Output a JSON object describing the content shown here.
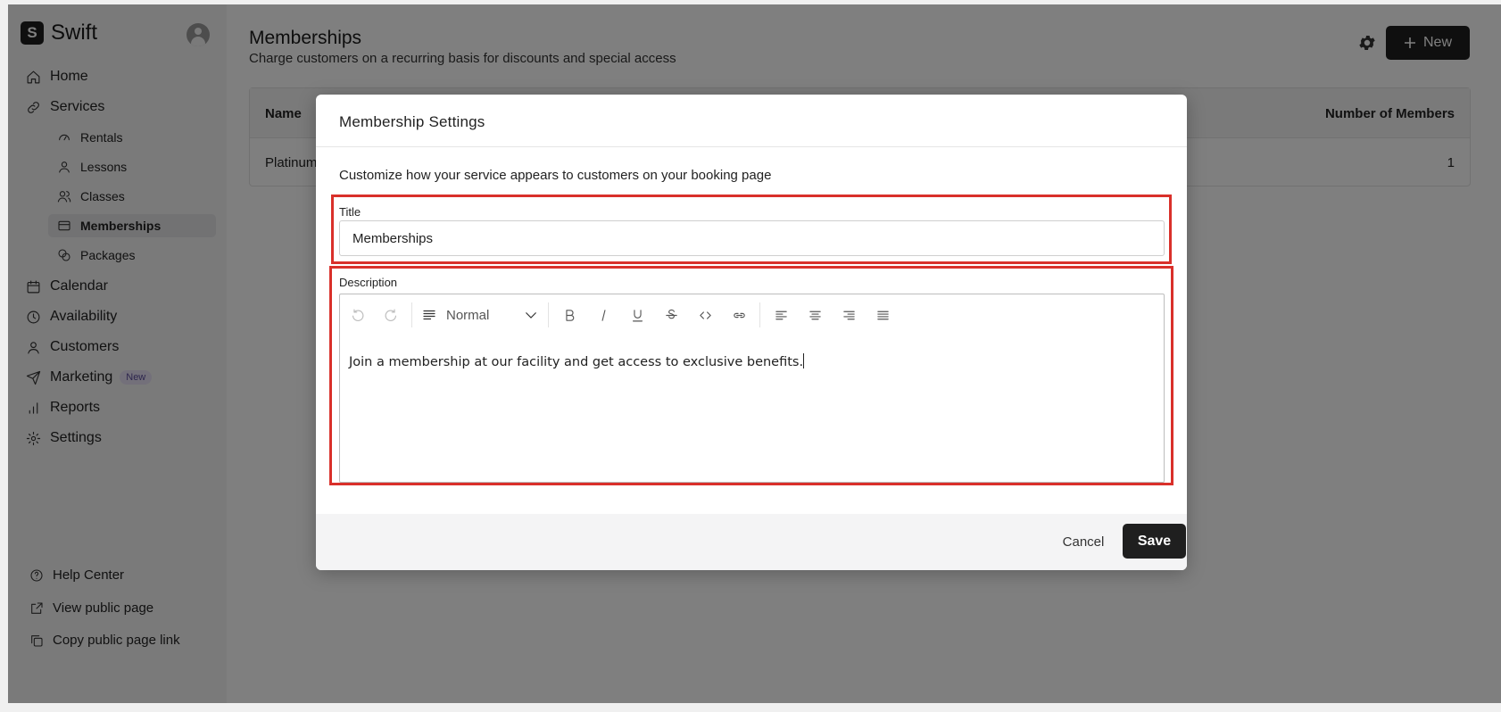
{
  "app": {
    "name": "Swift",
    "logo_letter": "S"
  },
  "sidebar": {
    "items": [
      {
        "label": "Home",
        "icon": "home-icon"
      },
      {
        "label": "Services",
        "icon": "link-icon"
      },
      {
        "label": "Calendar",
        "icon": "calendar-icon"
      },
      {
        "label": "Availability",
        "icon": "clock-icon"
      },
      {
        "label": "Customers",
        "icon": "user-icon"
      },
      {
        "label": "Marketing",
        "icon": "send-icon",
        "badge": "New"
      },
      {
        "label": "Reports",
        "icon": "bar-chart-icon"
      },
      {
        "label": "Settings",
        "icon": "gear-icon"
      }
    ],
    "sub_items": [
      {
        "label": "Rentals",
        "icon": "gauge-icon"
      },
      {
        "label": "Lessons",
        "icon": "user-icon"
      },
      {
        "label": "Classes",
        "icon": "users-icon"
      },
      {
        "label": "Memberships",
        "icon": "card-icon",
        "active": true
      },
      {
        "label": "Packages",
        "icon": "coins-icon"
      }
    ],
    "footer_links": [
      {
        "label": "Help Center",
        "icon": "help-circle-icon"
      },
      {
        "label": "View public page",
        "icon": "external-link-icon"
      },
      {
        "label": "Copy public page link",
        "icon": "copy-icon"
      }
    ]
  },
  "page": {
    "title": "Memberships",
    "subtitle": "Charge customers on a recurring basis for discounts and special access",
    "new_button": "New"
  },
  "table": {
    "columns": [
      "Name",
      "Number of Members"
    ],
    "rows": [
      {
        "name": "Platinum",
        "members": "1"
      }
    ]
  },
  "modal": {
    "title": "Membership Settings",
    "description": "Customize how your service appears to customers on your booking page",
    "title_field": {
      "label": "Title",
      "value": "Memberships"
    },
    "description_field": {
      "label": "Description",
      "block_type": "Normal",
      "content": "Join a membership at our facility and get access to exclusive benefits."
    },
    "cancel_label": "Cancel",
    "save_label": "Save"
  },
  "colors": {
    "highlight": "#d9302a",
    "primary_button": "#1f1f1f",
    "badge_bg": "#e6e0f5"
  }
}
